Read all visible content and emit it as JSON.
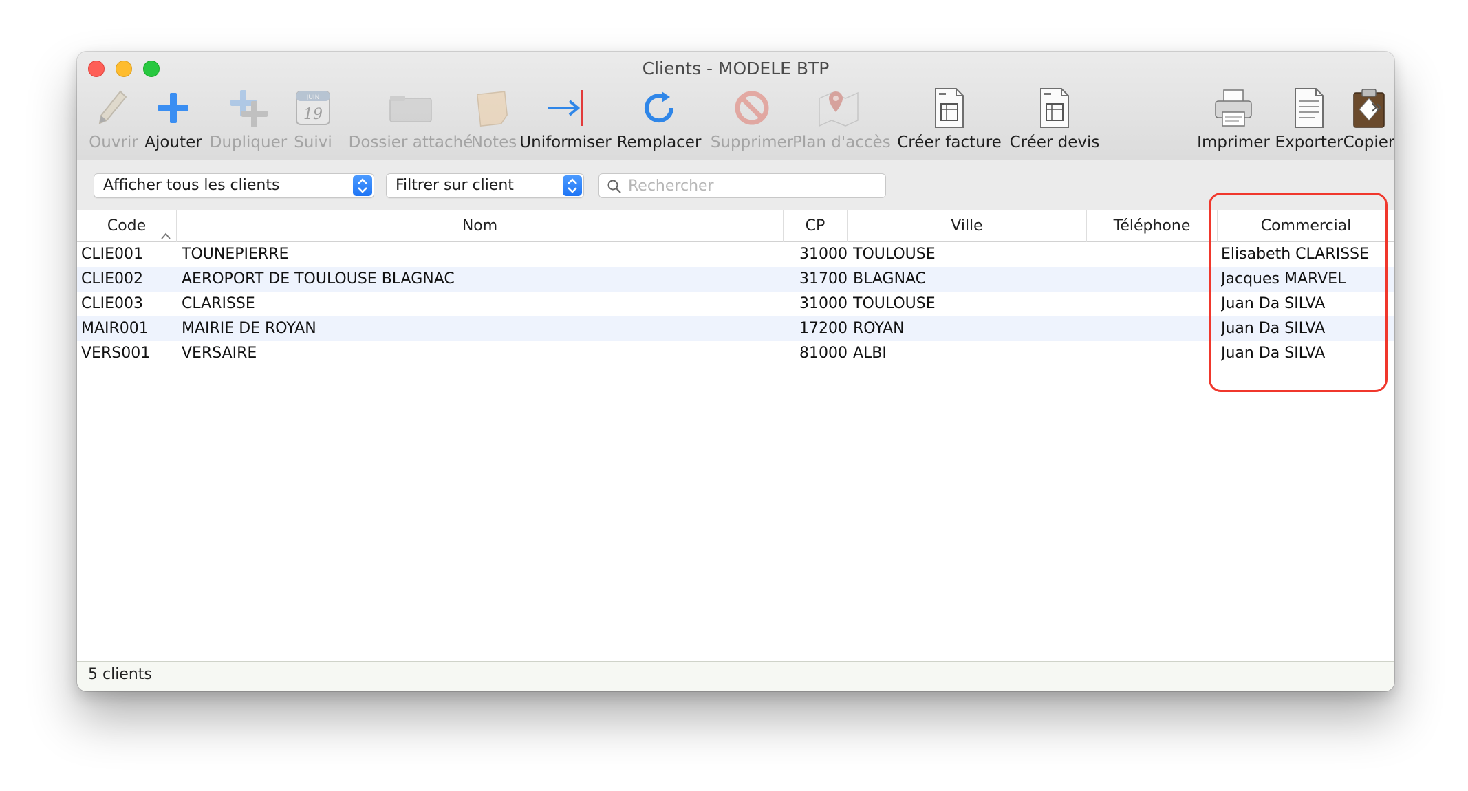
{
  "window": {
    "title": "Clients - MODELE BTP"
  },
  "toolbar": {
    "items": [
      {
        "label": "Ouvrir",
        "icon": "pencil-icon",
        "enabled": false
      },
      {
        "label": "Ajouter",
        "icon": "plus-icon",
        "enabled": true
      },
      {
        "label": "Dupliquer",
        "icon": "duplicate-plus-icon",
        "enabled": false
      },
      {
        "label": "Suivi",
        "icon": "calendar-icon",
        "enabled": false,
        "icon_text": {
          "month": "JUIN",
          "day": "19"
        }
      },
      {
        "label": "Dossier attaché",
        "icon": "folder-icon",
        "enabled": false
      },
      {
        "label": "Notes",
        "icon": "note-icon",
        "enabled": false
      },
      {
        "label": "Uniformiser",
        "icon": "arrow-right-bar-icon",
        "enabled": true
      },
      {
        "label": "Remplacer",
        "icon": "refresh-icon",
        "enabled": true
      },
      {
        "label": "Supprimer",
        "icon": "prohibited-icon",
        "enabled": false
      },
      {
        "label": "Plan d'accès",
        "icon": "map-pin-icon",
        "enabled": false
      },
      {
        "label": "Créer facture",
        "icon": "invoice-document-icon",
        "enabled": true
      },
      {
        "label": "Créer devis",
        "icon": "quote-document-icon",
        "enabled": true
      },
      {
        "label": "Imprimer",
        "icon": "printer-icon",
        "enabled": true
      },
      {
        "label": "Exporter",
        "icon": "export-document-icon",
        "enabled": true
      },
      {
        "label": "Copier",
        "icon": "clipboard-icon",
        "enabled": true
      }
    ],
    "overflow_glyph": "»"
  },
  "filters": {
    "show_select": {
      "value": "Afficher tous les clients"
    },
    "filter_select": {
      "value": "Filtrer sur client"
    },
    "search": {
      "placeholder": "Rechercher",
      "value": ""
    }
  },
  "table": {
    "columns": [
      "Code",
      "Nom",
      "CP",
      "Ville",
      "Téléphone",
      "Commercial"
    ],
    "sort": {
      "column": "Code",
      "direction": "ascending"
    },
    "rows": [
      {
        "code": "CLIE001",
        "nom": "TOUNEPIERRE",
        "cp": "31000",
        "ville": "TOULOUSE",
        "telephone": "",
        "commercial": "Elisabeth CLARISSE"
      },
      {
        "code": "CLIE002",
        "nom": "AEROPORT DE TOULOUSE BLAGNAC",
        "cp": "31700",
        "ville": "BLAGNAC",
        "telephone": "",
        "commercial": "Jacques MARVEL"
      },
      {
        "code": "CLIE003",
        "nom": "CLARISSE",
        "cp": "31000",
        "ville": "TOULOUSE",
        "telephone": "",
        "commercial": "Juan Da SILVA"
      },
      {
        "code": "MAIR001",
        "nom": "MAIRIE DE ROYAN",
        "cp": "17200",
        "ville": "ROYAN",
        "telephone": "",
        "commercial": "Juan Da SILVA"
      },
      {
        "code": "VERS001",
        "nom": "VERSAIRE",
        "cp": "81000",
        "ville": "ALBI",
        "telephone": "",
        "commercial": "Juan Da SILVA"
      }
    ]
  },
  "status": {
    "text": "5 clients"
  },
  "colors": {
    "accent": "#1f75f5",
    "highlight": "#f0372c",
    "row_alt": "#eef3fd"
  }
}
